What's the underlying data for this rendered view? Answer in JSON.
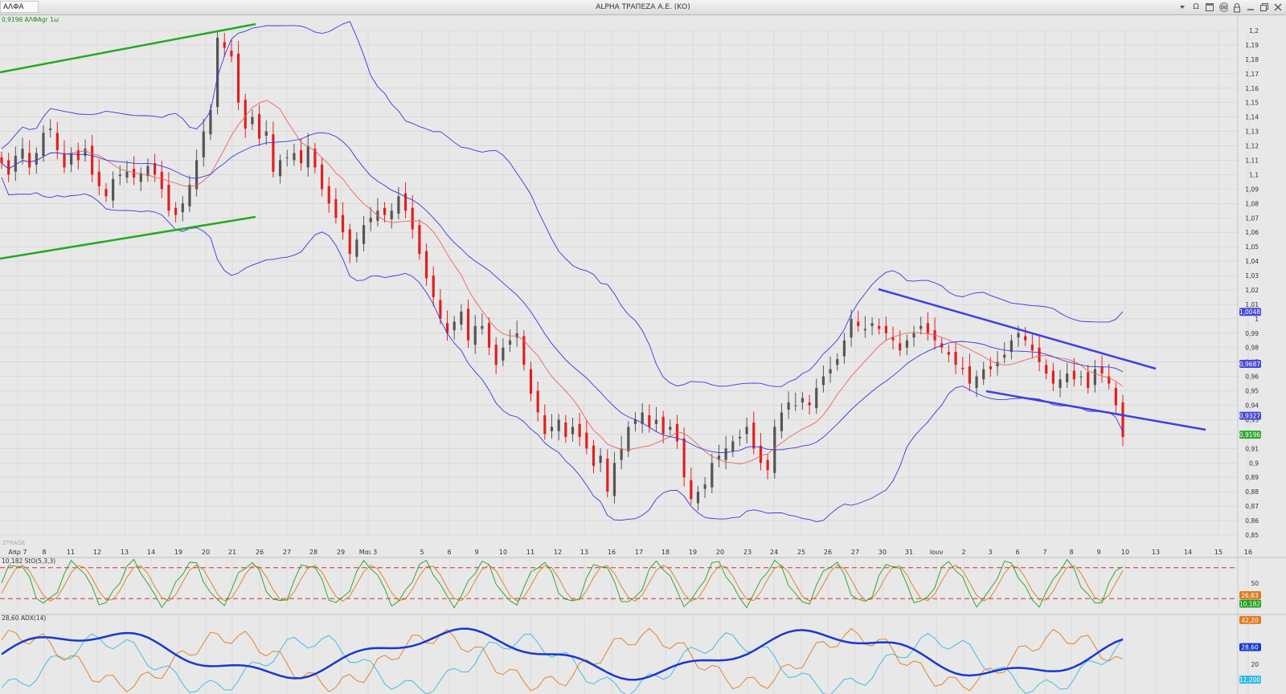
{
  "window": {
    "symbol": "ΑΛΦΑ",
    "title": "ALPHA ΤΡΑΠΕΖΑ Α.Ε. (ΚΟ)",
    "omega_label": "Ω"
  },
  "colors": {
    "bull": "#555555",
    "bear": "#e02020",
    "bollinger": "#3838e0",
    "ma": "#f06060",
    "green_channel": "#22aa22",
    "blue_channel": "#4040e0",
    "stoch_k": "#22a022",
    "stoch_d": "#e07a20",
    "adx": "#1838d0",
    "di_plus": "#e07a20",
    "di_minus": "#30b8e8",
    "grid": "#d0d0d0"
  },
  "icons": [
    "dropdown-icon",
    "omega-icon",
    "window-icon",
    "glasses-icon",
    "lock-icon",
    "minimize-icon",
    "restore-icon",
    "close-icon"
  ],
  "chart_data": [
    {
      "type": "candlestick",
      "label": "0,9196 ΑΛΦΑgr 1ω",
      "watermark": "ZTRADE",
      "ylim": [
        0.85,
        1.2
      ],
      "y_ticks": [
        "1,2",
        "1,19",
        "1,18",
        "1,17",
        "1,16",
        "1,15",
        "1,14",
        "1,13",
        "1,12",
        "1,11",
        "1,1",
        "1,09",
        "1,08",
        "1,07",
        "1,06",
        "1,05",
        "1,04",
        "1,03",
        "1,02",
        "1,01",
        "1",
        "0,99",
        "0,98",
        "0,97",
        "0,96",
        "0,95",
        "0,94",
        "0,93",
        "0,92",
        "0,91",
        "0,9",
        "0,89",
        "0,88",
        "0,87",
        "0,86",
        "0,85"
      ],
      "x_ticks": [
        "Απρ 7",
        "8",
        "11",
        "12",
        "13",
        "14",
        "19",
        "20",
        "21",
        "26",
        "27",
        "28",
        "29",
        "Μαι 3",
        "5",
        "6",
        "9",
        "10",
        "11",
        "12",
        "13",
        "16",
        "17",
        "18",
        "19",
        "20",
        "23",
        "24",
        "25",
        "26",
        "27",
        "30",
        "31",
        "Ιουν",
        "2",
        "3",
        "6",
        "7",
        "8",
        "9",
        "10",
        "13",
        "14",
        "15",
        "16"
      ],
      "price_tags": [
        {
          "text": "1,0048",
          "value": 1.0048,
          "color": "#4848d8"
        },
        {
          "text": "0,9687",
          "value": 0.9687,
          "color": "#4848d8"
        },
        {
          "text": "0,9327",
          "value": 0.9327,
          "color": "#4848d8"
        },
        {
          "text": "0,9196",
          "value": 0.9196,
          "color": "#2ea82e"
        }
      ],
      "closes": [
        1.108,
        1.1,
        1.113,
        1.118,
        1.105,
        1.115,
        1.129,
        1.132,
        1.117,
        1.105,
        1.115,
        1.11,
        1.118,
        1.1,
        1.092,
        1.085,
        1.097,
        1.1,
        1.102,
        1.098,
        1.101,
        1.106,
        1.1,
        1.09,
        1.075,
        1.072,
        1.08,
        1.093,
        1.11,
        1.13,
        1.145,
        1.195,
        1.188,
        1.182,
        1.15,
        1.132,
        1.14,
        1.125,
        1.13,
        1.102,
        1.11,
        1.112,
        1.115,
        1.108,
        1.12,
        1.105,
        1.09,
        1.08,
        1.07,
        1.06,
        1.045,
        1.055,
        1.065,
        1.07,
        1.075,
        1.072,
        1.075,
        1.085,
        1.075,
        1.062,
        1.045,
        1.028,
        1.015,
        1.0,
        0.99,
        0.998,
        1.005,
        0.985,
        0.995,
        0.995,
        0.98,
        0.968,
        0.98,
        0.985,
        0.99,
        0.968,
        0.948,
        0.935,
        0.92,
        0.925,
        0.93,
        0.918,
        0.925,
        0.918,
        0.91,
        0.898,
        0.905,
        0.88,
        0.9,
        0.91,
        0.925,
        0.93,
        0.935,
        0.925,
        0.93,
        0.92,
        0.925,
        0.915,
        0.89,
        0.875,
        0.88,
        0.885,
        0.9,
        0.905,
        0.91,
        0.915,
        0.918,
        0.925,
        0.91,
        0.9,
        0.895,
        0.925,
        0.935,
        0.942,
        0.94,
        0.945,
        0.94,
        0.952,
        0.96,
        0.965,
        0.972,
        0.985,
        1.0,
        0.995,
        0.993,
        0.997,
        0.993,
        0.99,
        0.985,
        0.978,
        0.985,
        0.99,
        0.995,
        0.99,
        0.985,
        0.98,
        0.975,
        0.968,
        0.965,
        0.955,
        0.96,
        0.965,
        0.965,
        0.97,
        0.975,
        0.985,
        0.99,
        0.985,
        0.978,
        0.97,
        0.962,
        0.955,
        0.958,
        0.962,
        0.958,
        0.96,
        0.952,
        0.965,
        0.962,
        0.955,
        0.94,
        0.918
      ]
    },
    {
      "type": "line",
      "label": "10,182 StO(5,3,3)",
      "ylim": [
        0,
        100
      ],
      "y_ticks": [
        "50"
      ],
      "reference_lines": [
        80,
        20
      ],
      "price_tags": [
        {
          "text": "26,63",
          "color": "#e07a20"
        },
        {
          "text": "10,182",
          "color": "#22a022"
        }
      ]
    },
    {
      "type": "line",
      "label": "28,60 ADX(14)",
      "ylim": [
        5,
        45
      ],
      "y_ticks": [
        "20"
      ],
      "price_tags": [
        {
          "text": "42,20",
          "color": "#e07a20"
        },
        {
          "text": "28,60",
          "color": "#1838d0"
        },
        {
          "text": "12,200",
          "color": "#30b8e8"
        }
      ]
    }
  ]
}
